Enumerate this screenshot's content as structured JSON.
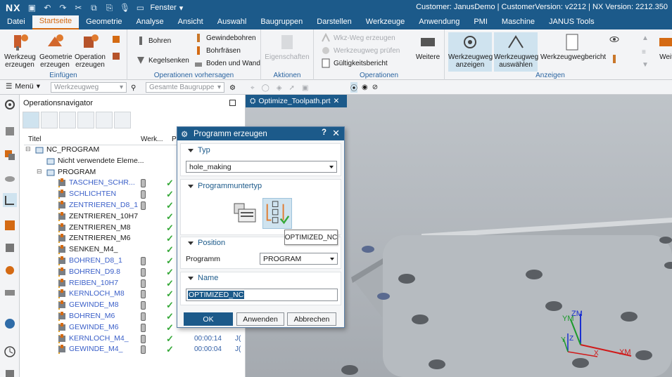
{
  "titlebar": {
    "logo": "NX",
    "window_menu": "Fenster",
    "title": "Customer: JanusDemo | CustomerVersion: v2212 | NX Version: 2212.350"
  },
  "tabs": [
    "Datei",
    "Startseite",
    "Geometrie",
    "Analyse",
    "Ansicht",
    "Auswahl",
    "Baugruppen",
    "Darstellen",
    "Werkzeuge",
    "Anwendung",
    "PMI",
    "Maschine",
    "JANUS Tools"
  ],
  "active_tab": "Startseite",
  "ribbon": {
    "einfuegen": {
      "label": "Einfügen",
      "werkzeug": "Werkzeug erzeugen",
      "geometrie": "Geometrie erzeugen",
      "operation": "Operation erzeugen"
    },
    "operationen_vorhersagen": {
      "label": "Operationen vorhersagen",
      "bohren": "Bohren",
      "kegelsenken": "Kegelsenken",
      "gewindebohren": "Gewindebohren",
      "bohrfraesen": "Bohrfräsen",
      "boden_wand": "Boden und Wand"
    },
    "aktionen": {
      "label": "Aktionen",
      "eigenschaften": "Eigenschaften"
    },
    "operationen": {
      "label": "Operationen",
      "wkz_weg_erzeugen": "Wkz-Weg erzeugen",
      "werkzeugweg_pruefen": "Werkzeugweg prüfen",
      "gueltigkeitsbericht": "Gültigkeitsbericht",
      "weitere": "Weitere"
    },
    "anzeigen": {
      "label": "Anzeigen",
      "werkzeugweg_anzeigen": "Werkzeugweg anzeigen",
      "werkzeugweg_auswaehlen": "Werkzeugweg auswählen",
      "werkzeugwegbericht": "Werkzeugwegbericht",
      "more": "Weit"
    }
  },
  "toolbar2": {
    "menu": "Menü",
    "filter1": "Werkzeugweg",
    "filter2": "Gesamte Baugruppe"
  },
  "navigator": {
    "title": "Operationsnavigator",
    "columns": [
      "Titel",
      "Werk...",
      "Pfa"
    ],
    "rows": [
      {
        "label": "NC_PROGRAM",
        "indent": 0,
        "kind": "root"
      },
      {
        "label": "Nicht verwendete Eleme...",
        "indent": 1,
        "kind": "folder"
      },
      {
        "label": "PROGRAM",
        "indent": 1,
        "kind": "folder"
      },
      {
        "label": "TASCHEN_SCHR...",
        "indent": 2,
        "kind": "op",
        "blue": true,
        "tool": true,
        "check": true
      },
      {
        "label": "SCHLICHTEN",
        "indent": 2,
        "kind": "op",
        "blue": true,
        "tool": true,
        "check": true
      },
      {
        "label": "ZENTRIEREN_D8_1",
        "indent": 2,
        "kind": "op",
        "blue": true,
        "tool": true,
        "check": true
      },
      {
        "label": "ZENTRIEREN_10H7",
        "indent": 2,
        "kind": "op",
        "blue": false,
        "tool": false,
        "check": true
      },
      {
        "label": "ZENTRIEREN_M8",
        "indent": 2,
        "kind": "op",
        "blue": false,
        "tool": false,
        "check": true
      },
      {
        "label": "ZENTRIEREN_M6",
        "indent": 2,
        "kind": "op",
        "blue": false,
        "tool": false,
        "check": true
      },
      {
        "label": "SENKEN_M4_",
        "indent": 2,
        "kind": "op",
        "blue": false,
        "tool": false,
        "check": true
      },
      {
        "label": "BOHREN_D8_1",
        "indent": 2,
        "kind": "op",
        "blue": true,
        "tool": true,
        "check": true
      },
      {
        "label": "BOHREN_D9.8",
        "indent": 2,
        "kind": "op",
        "blue": true,
        "tool": true,
        "check": true
      },
      {
        "label": "REIBEN_10H7",
        "indent": 2,
        "kind": "op",
        "blue": true,
        "tool": true,
        "check": true
      },
      {
        "label": "KERNLOCH_M8",
        "indent": 2,
        "kind": "op",
        "blue": true,
        "tool": true,
        "check": true
      },
      {
        "label": "GEWINDE_M8",
        "indent": 2,
        "kind": "op",
        "blue": true,
        "tool": true,
        "check": true
      },
      {
        "label": "BOHREN_M6",
        "indent": 2,
        "kind": "op",
        "blue": true,
        "tool": true,
        "check": true
      },
      {
        "label": "GEWINDE_M6",
        "indent": 2,
        "kind": "op",
        "blue": true,
        "tool": true,
        "check": true
      },
      {
        "label": "KERNLOCH_M4_",
        "indent": 2,
        "kind": "op",
        "blue": true,
        "tool": true,
        "check": true,
        "time": "00:00:14",
        "extra": "J("
      },
      {
        "label": "GEWINDE_M4_",
        "indent": 2,
        "kind": "op",
        "blue": true,
        "tool": true,
        "check": true,
        "time": "00:00:04",
        "extra": "J("
      }
    ]
  },
  "viewport": {
    "tab": "Optimize_Toolpath.prt",
    "axes": {
      "zm": "ZM",
      "ym": "YM",
      "xm": "XM",
      "x": "X",
      "y": "Y",
      "z": "Z"
    }
  },
  "dialog": {
    "title": "Programm erzeugen",
    "help": "?",
    "close": "✕",
    "typ": {
      "header": "Typ",
      "value": "hole_making"
    },
    "untertyp": {
      "header": "Programmuntertyp"
    },
    "position": {
      "header": "Position",
      "label": "Programm",
      "value": "PROGRAM"
    },
    "name": {
      "header": "Name",
      "value": "OPTIMIZED_NC"
    },
    "buttons": {
      "ok": "OK",
      "apply": "Anwenden",
      "cancel": "Abbrechen"
    }
  },
  "tooltip": "OPTIMIZED_NC",
  "colors": {
    "accent": "#1c5a8a",
    "active_tab": "#d46a13",
    "check": "#35a838",
    "link_blue": "#3a5fc8"
  }
}
